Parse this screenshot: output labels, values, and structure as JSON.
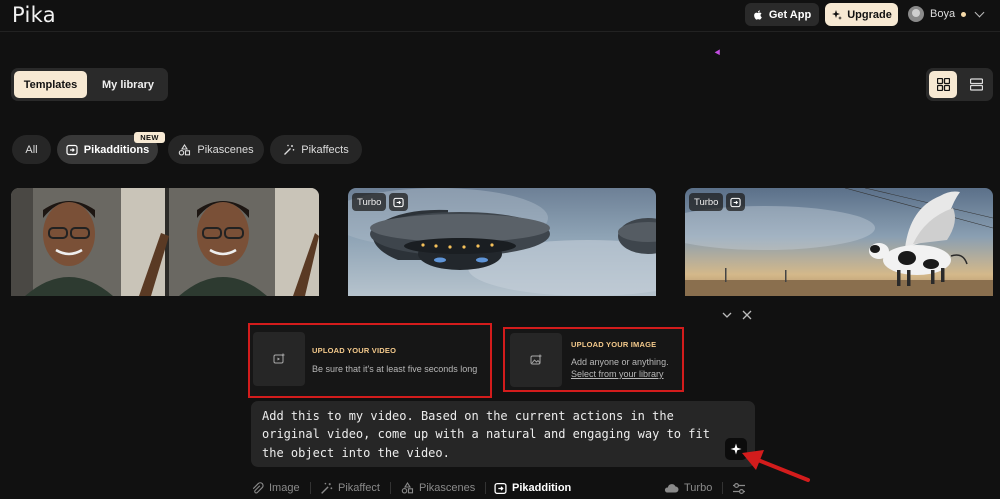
{
  "header": {
    "logo": "Pika",
    "get_app_label": "Get App",
    "upgrade_label": "Upgrade",
    "user_name": "Boya"
  },
  "tabs": {
    "templates": "Templates",
    "my_library": "My library"
  },
  "categories": {
    "all": "All",
    "pikadditions": "Pikadditions",
    "new_badge": "NEW",
    "pikascenes": "Pikascenes",
    "pikaffects": "Pikaffects"
  },
  "cards": [
    {
      "badge": ""
    },
    {
      "badge": "Turbo"
    },
    {
      "badge": "Turbo"
    }
  ],
  "upload_video": {
    "title": "UPLOAD YOUR VIDEO",
    "subtitle": "Be sure that it's at least five seconds long"
  },
  "upload_image": {
    "title": "UPLOAD YOUR IMAGE",
    "subtitle": "Add anyone or anything.",
    "link": "Select from your library"
  },
  "prompt": {
    "text": "Add this to my video. Based on the current actions in the original video, come up with a natural and engaging way to fit the object into the video."
  },
  "toolbar": {
    "image": "Image",
    "pikaffect": "Pikaffect",
    "pikascenes": "Pikascenes",
    "pikaddition": "Pikaddition",
    "turbo": "Turbo"
  },
  "colors": {
    "background": "#111111",
    "accent_cream": "#f7e9d3",
    "upload_title": "#f3c98b",
    "highlight_red": "#d31c1c"
  }
}
